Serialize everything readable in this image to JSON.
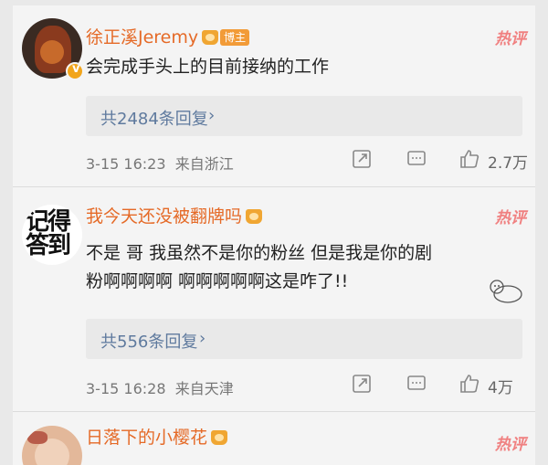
{
  "comments": [
    {
      "username": "徐正溪Jeremy",
      "author_tag": "博主",
      "hot_label": "热评",
      "text": "会完成手头上的目前接纳的工作",
      "replies_label": "共2484条回复",
      "date": "3-15 16:23",
      "location": "来自浙江",
      "likes": "2.7万"
    },
    {
      "username": "我今天还没被翻牌吗",
      "hot_label": "热评",
      "avatar_text": "记得 答到",
      "text_line1": "不是  哥  我虽然不是你的粉丝  但是我是你的剧",
      "text_line2": "粉啊啊啊啊  啊啊啊啊啊这是咋了!!",
      "replies_label": "共556条回复",
      "date": "3-15 16:28",
      "location": "来自天津",
      "likes": "4万"
    },
    {
      "username": "日落下的小樱花",
      "hot_label": "热评"
    }
  ],
  "colors": {
    "username": "#e56a27",
    "hot": "#f08080",
    "replies": "#5f7a9e"
  },
  "icons": [
    "share-icon",
    "comment-icon",
    "like-icon",
    "chevron-right-icon",
    "verified-badge-icon",
    "crown-icon"
  ]
}
